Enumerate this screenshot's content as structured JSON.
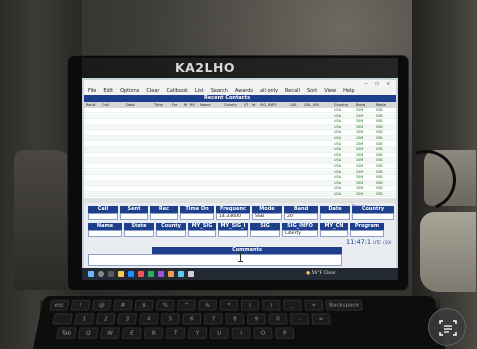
{
  "tablet": {
    "callsign": "KA2LHO",
    "bezel_right": ""
  },
  "window": {
    "title": "",
    "title_center": "",
    "controls": "— ☐ ✕"
  },
  "menu": [
    "File",
    "Edit",
    "Options",
    "Clear",
    "Callbook",
    "List",
    "Search",
    "Awards",
    "all only",
    "Recall",
    "Sort",
    "View",
    "Help"
  ],
  "grid": {
    "title": "Recent Contacts",
    "right_info": "",
    "columns": [
      "Rec#",
      "Call",
      "Date",
      "Time",
      "Fre",
      "M",
      "RS",
      "Name",
      "County",
      "ST",
      "Id",
      "SIG_INFO",
      "QSL",
      "QSL_VIA",
      "Country",
      "Band",
      "Mode"
    ],
    "rows": [
      [
        "",
        "",
        "",
        "",
        "",
        "",
        "",
        "",
        "",
        "",
        "",
        "",
        "",
        "",
        "USA",
        "20M",
        "SSB"
      ],
      [
        "",
        "",
        "",
        "",
        "",
        "",
        "",
        "",
        "",
        "",
        "",
        "",
        "",
        "",
        "USA",
        "20M",
        "SSB"
      ],
      [
        "",
        "",
        "",
        "",
        "",
        "",
        "",
        "",
        "",
        "",
        "",
        "",
        "",
        "",
        "USA",
        "20M",
        "SSB"
      ],
      [
        "",
        "",
        "",
        "",
        "",
        "",
        "",
        "",
        "",
        "",
        "",
        "",
        "",
        "",
        "USA",
        "20M",
        "SSB"
      ],
      [
        "",
        "",
        "",
        "",
        "",
        "",
        "",
        "",
        "",
        "",
        "",
        "",
        "",
        "",
        "USA",
        "20M",
        "SSB"
      ],
      [
        "",
        "",
        "",
        "",
        "",
        "",
        "",
        "",
        "",
        "",
        "",
        "",
        "",
        "",
        "USA",
        "20M",
        "SSB"
      ],
      [
        "",
        "",
        "",
        "",
        "",
        "",
        "",
        "",
        "",
        "",
        "",
        "",
        "",
        "",
        "USA",
        "20M",
        "SSB"
      ],
      [
        "",
        "",
        "",
        "",
        "",
        "",
        "",
        "",
        "",
        "",
        "",
        "",
        "",
        "",
        "USA",
        "20M",
        "SSB"
      ],
      [
        "",
        "",
        "",
        "",
        "",
        "",
        "",
        "",
        "",
        "",
        "",
        "",
        "",
        "",
        "USA",
        "20M",
        "SSB"
      ],
      [
        "",
        "",
        "",
        "",
        "",
        "",
        "",
        "",
        "",
        "",
        "",
        "",
        "",
        "",
        "USA",
        "20M",
        "SSB"
      ],
      [
        "",
        "",
        "",
        "",
        "",
        "",
        "",
        "",
        "",
        "",
        "",
        "",
        "",
        "",
        "USA",
        "20M",
        "SSB"
      ],
      [
        "",
        "",
        "",
        "",
        "",
        "",
        "",
        "",
        "",
        "",
        "",
        "",
        "",
        "",
        "USA",
        "20M",
        "SSB"
      ],
      [
        "",
        "",
        "",
        "",
        "",
        "",
        "",
        "",
        "",
        "",
        "",
        "",
        "",
        "",
        "USA",
        "20M",
        "SSB"
      ],
      [
        "",
        "",
        "",
        "",
        "",
        "",
        "",
        "",
        "",
        "",
        "",
        "",
        "",
        "",
        "USA",
        "20M",
        "SSB"
      ],
      [
        "",
        "",
        "",
        "",
        "",
        "",
        "",
        "",
        "",
        "",
        "",
        "",
        "",
        "",
        "USA",
        "20M",
        "SSB"
      ],
      [
        "",
        "",
        "",
        "",
        "",
        "",
        "",
        "",
        "",
        "",
        "",
        "",
        "",
        "",
        "USA",
        "20M",
        "SSB"
      ]
    ]
  },
  "status_line": "",
  "form": {
    "labels_row1": [
      "Call",
      "Sent",
      "Rec",
      "Time On",
      "Frequenc",
      "Mode",
      "Band",
      "Date",
      "Country"
    ],
    "values_row1": [
      "",
      "",
      "",
      "",
      "14.33600",
      "SSB",
      "20",
      "",
      ""
    ],
    "labels_row2": [
      "Name",
      "State",
      "County",
      "MY_SIG",
      "MY_SIG_I",
      "SIG",
      "SIG_INFO",
      "MY_CN",
      "Program"
    ],
    "values_row2": [
      "",
      "",
      "",
      "",
      "",
      "",
      "Liberty",
      "",
      ""
    ],
    "comments_label": "Comments",
    "side_top": "Recent",
    "side_sub": "Only",
    "big_time": "11:47:1",
    "utc": "UTC",
    "utc_value": "(10)"
  },
  "taskbar": {
    "weather": "56°F Clear",
    "clock": ""
  },
  "keyboard": {
    "row1": [
      "esc",
      "!",
      "@",
      "#",
      "$",
      "%",
      "^",
      "&",
      "*",
      "(",
      ")",
      "_",
      "+",
      "Backspace"
    ],
    "row2": [
      "",
      "1",
      "2",
      "3",
      "4",
      "5",
      "6",
      "7",
      "8",
      "9",
      "0",
      "-",
      "="
    ],
    "row3": [
      "Tab",
      "Q",
      "W",
      "E",
      "R",
      "T",
      "Y",
      "U",
      "I",
      "O",
      "P"
    ]
  },
  "colors": {
    "header_blue": "#1d3f8c",
    "row_green": "#1a6a1a",
    "taskbar": "#232a33"
  }
}
